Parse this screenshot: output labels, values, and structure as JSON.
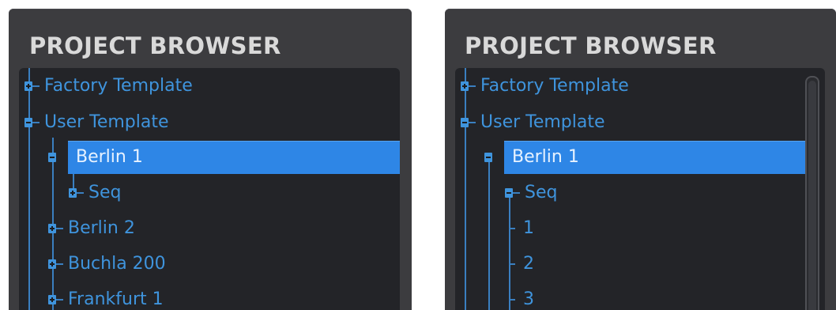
{
  "left_panel": {
    "title": "PROJECT BROWSER",
    "items": [
      {
        "label": "Factory Template",
        "expander": "plus"
      },
      {
        "label": "User Template",
        "expander": "minus"
      },
      {
        "label": "Berlin 1",
        "expander": "minus",
        "selected": true
      },
      {
        "label": "Seq",
        "expander": "plus"
      },
      {
        "label": "Berlin 2",
        "expander": "plus"
      },
      {
        "label": "Buchla 200",
        "expander": "plus"
      },
      {
        "label": "Frankfurt 1",
        "expander": "plus"
      }
    ]
  },
  "right_panel": {
    "title": "PROJECT BROWSER",
    "items": [
      {
        "label": "Factory Template",
        "expander": "plus"
      },
      {
        "label": "User Template",
        "expander": "minus"
      },
      {
        "label": "Berlin 1",
        "expander": "minus",
        "selected": true
      },
      {
        "label": "Seq",
        "expander": "minus"
      },
      {
        "label": "1",
        "expander": "none"
      },
      {
        "label": "2",
        "expander": "none"
      },
      {
        "label": "3",
        "expander": "none"
      }
    ]
  },
  "colors": {
    "panel": "#3c3c3f",
    "tree_background": "#232428",
    "item_text": "#3f94dd",
    "selection": "#2e86e6"
  }
}
